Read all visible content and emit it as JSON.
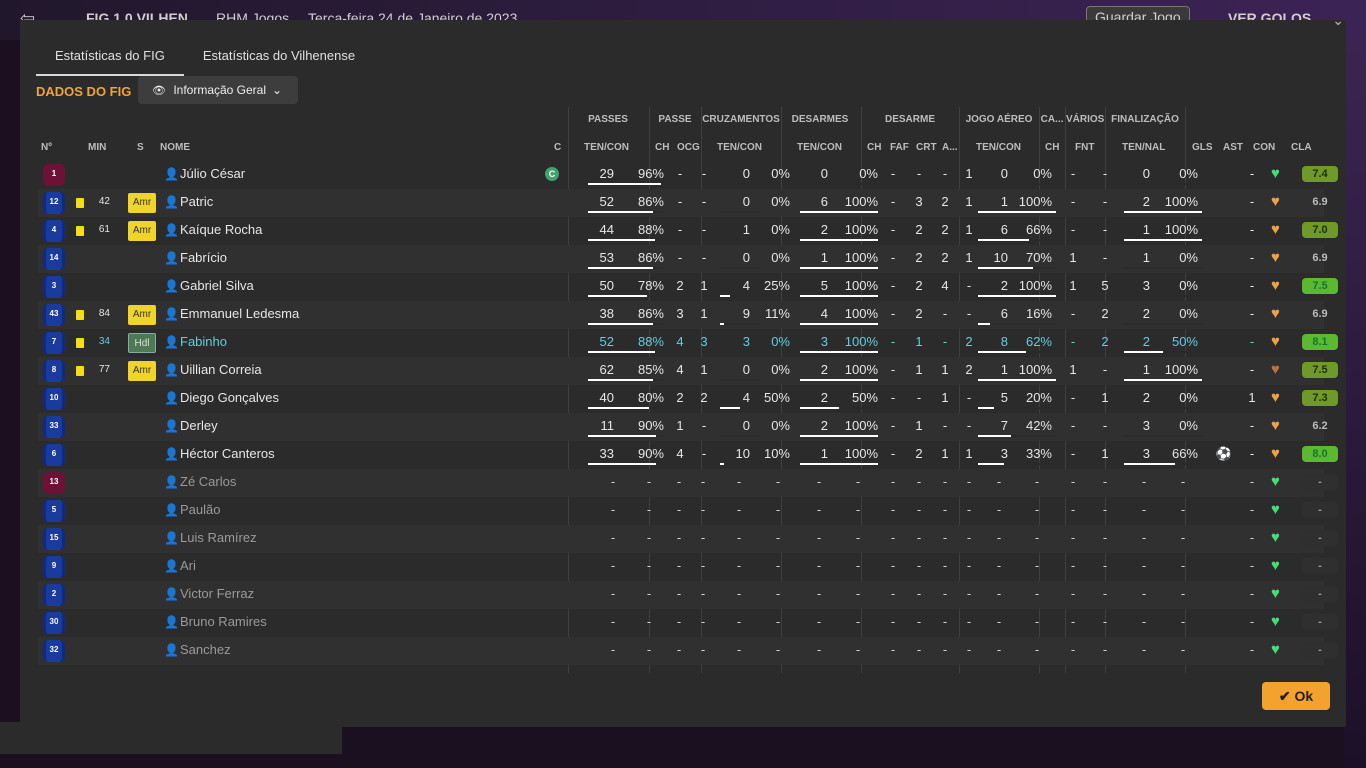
{
  "background": {
    "back_glyph": "⇦",
    "score": "FIG 1 0 VILHEN",
    "event": "RHM Jogos",
    "date": "Terça-feira 24 de Janeiro de 2023",
    "save_label": "Guardar Jogo",
    "goals_label": "VER GOLOS"
  },
  "tabs": [
    "Estatísticas do FIG",
    "Estatísticas do Vilhenense"
  ],
  "section_title": "DADOS DO FIG",
  "dropdown": {
    "label": "Informação Geral"
  },
  "group_headers": {
    "passes": "PASSES",
    "passe": "PASSE",
    "cruz": "CRUZAMENTOS",
    "desarmes": "DESARMES",
    "desarme": "DESARME",
    "aereo": "JOGO AÉREO",
    "ca": "CA...",
    "varios": "VÁRIOS",
    "final": "FINALIZAÇÃO"
  },
  "col_headers": {
    "no": "Nº",
    "min": "MIN",
    "s": "S",
    "nome": "NOME",
    "c": "C",
    "p_tc": "TEN/CON",
    "ps_ch": "CH",
    "ps_ocg": "OCG",
    "cr_tc": "TEN/CON",
    "ds_tc": "TEN/CON",
    "d_ch": "CH",
    "d_faf": "FAF",
    "d_crt": "CRT",
    "d_a": "A...",
    "ae_tc": "TEN/CON",
    "ca_ch": "CH",
    "v_fnt": "FNT",
    "f_tn": "TEN/NAL",
    "gls": "GLS",
    "ast": "AST",
    "con": "CON",
    "cla": "CLA"
  },
  "players": [
    {
      "no": "1",
      "gk": true,
      "min": "",
      "card": false,
      "pos": "",
      "name": "Júlio César",
      "captain": true,
      "p": [
        "29",
        "96%"
      ],
      "p_pct": 96,
      "ch": "-",
      "ocg": "-",
      "cr": [
        "0",
        "0%"
      ],
      "cr_pct": 0,
      "ds": [
        "0",
        "0%"
      ],
      "ds_pct": 0,
      "dch": "-",
      "faf": "-",
      "crt": "-",
      "da": "1",
      "ae": [
        "0",
        "0%"
      ],
      "ae_pct": 0,
      "cach": "-",
      "fnt": "-",
      "fi": [
        "0",
        "0%"
      ],
      "fi_pct": 0,
      "gls": "",
      "ast": "-",
      "con": "green",
      "cla": "7.4",
      "cla_lvl": "md"
    },
    {
      "no": "12",
      "gk": false,
      "min": "42",
      "card": true,
      "pos": "Amr",
      "name": "Patric",
      "captain": false,
      "p": [
        "52",
        "86%"
      ],
      "p_pct": 86,
      "ch": "-",
      "ocg": "-",
      "cr": [
        "0",
        "0%"
      ],
      "cr_pct": 0,
      "ds": [
        "6",
        "100%"
      ],
      "ds_pct": 100,
      "dch": "-",
      "faf": "3",
      "crt": "2",
      "da": "1",
      "ae": [
        "1",
        "100%"
      ],
      "ae_pct": 100,
      "cach": "-",
      "fnt": "-",
      "fi": [
        "2",
        "100%"
      ],
      "fi_pct": 100,
      "gls": "",
      "ast": "-",
      "con": "orange",
      "cla": "6.9",
      "cla_lvl": "lo"
    },
    {
      "no": "4",
      "gk": false,
      "min": "61",
      "card": true,
      "pos": "Amr",
      "name": "Kaíque Rocha",
      "captain": false,
      "p": [
        "44",
        "88%"
      ],
      "p_pct": 88,
      "ch": "-",
      "ocg": "-",
      "cr": [
        "1",
        "0%"
      ],
      "cr_pct": 0,
      "ds": [
        "2",
        "100%"
      ],
      "ds_pct": 100,
      "dch": "-",
      "faf": "2",
      "crt": "2",
      "da": "1",
      "ae": [
        "6",
        "66%"
      ],
      "ae_pct": 66,
      "cach": "-",
      "fnt": "-",
      "fi": [
        "1",
        "100%"
      ],
      "fi_pct": 100,
      "gls": "",
      "ast": "-",
      "con": "orange",
      "cla": "7.0",
      "cla_lvl": "md"
    },
    {
      "no": "14",
      "gk": false,
      "min": "",
      "card": false,
      "pos": "",
      "name": "Fabrício",
      "captain": false,
      "p": [
        "53",
        "86%"
      ],
      "p_pct": 86,
      "ch": "-",
      "ocg": "-",
      "cr": [
        "0",
        "0%"
      ],
      "cr_pct": 0,
      "ds": [
        "1",
        "100%"
      ],
      "ds_pct": 100,
      "dch": "-",
      "faf": "2",
      "crt": "2",
      "da": "1",
      "ae": [
        "10",
        "70%"
      ],
      "ae_pct": 70,
      "cach": "1",
      "fnt": "-",
      "fi": [
        "1",
        "0%"
      ],
      "fi_pct": 0,
      "gls": "",
      "ast": "-",
      "con": "orange",
      "cla": "6.9",
      "cla_lvl": "lo"
    },
    {
      "no": "3",
      "gk": false,
      "min": "",
      "card": false,
      "pos": "",
      "name": "Gabriel Silva",
      "captain": false,
      "p": [
        "50",
        "78%"
      ],
      "p_pct": 78,
      "ch": "2",
      "ocg": "1",
      "cr": [
        "4",
        "25%"
      ],
      "cr_pct": 25,
      "ds": [
        "5",
        "100%"
      ],
      "ds_pct": 100,
      "dch": "-",
      "faf": "2",
      "crt": "4",
      "da": "-",
      "ae": [
        "2",
        "100%"
      ],
      "ae_pct": 100,
      "cach": "1",
      "fnt": "5",
      "fi": [
        "3",
        "0%"
      ],
      "fi_pct": 0,
      "gls": "",
      "ast": "-",
      "con": "orange",
      "cla": "7.5",
      "cla_lvl": "hi"
    },
    {
      "no": "43",
      "gk": false,
      "min": "84",
      "card": true,
      "pos": "Amr",
      "name": "Emmanuel Ledesma",
      "captain": false,
      "p": [
        "38",
        "86%"
      ],
      "p_pct": 86,
      "ch": "3",
      "ocg": "1",
      "cr": [
        "9",
        "11%"
      ],
      "cr_pct": 11,
      "ds": [
        "4",
        "100%"
      ],
      "ds_pct": 100,
      "dch": "-",
      "faf": "2",
      "crt": "-",
      "da": "-",
      "ae": [
        "6",
        "16%"
      ],
      "ae_pct": 16,
      "cach": "-",
      "fnt": "2",
      "fi": [
        "2",
        "0%"
      ],
      "fi_pct": 0,
      "gls": "",
      "ast": "-",
      "con": "orange",
      "cla": "6.9",
      "cla_lvl": "lo"
    },
    {
      "no": "7",
      "gk": false,
      "min": "34",
      "card": true,
      "pos": "Hdl",
      "name": "Fabinho",
      "captain": false,
      "highlight": true,
      "p": [
        "52",
        "88%"
      ],
      "p_pct": 88,
      "ch": "4",
      "ocg": "3",
      "cr": [
        "3",
        "0%"
      ],
      "cr_pct": 0,
      "ds": [
        "3",
        "100%"
      ],
      "ds_pct": 100,
      "dch": "-",
      "faf": "1",
      "crt": "-",
      "da": "2",
      "ae": [
        "8",
        "62%"
      ],
      "ae_pct": 62,
      "cach": "-",
      "fnt": "2",
      "fi": [
        "2",
        "50%"
      ],
      "fi_pct": 50,
      "gls": "",
      "ast": "-",
      "con": "orange",
      "cla": "8.1",
      "cla_lvl": "hi"
    },
    {
      "no": "8",
      "gk": false,
      "min": "77",
      "card": true,
      "pos": "Amr",
      "name": "Uillian Correia",
      "captain": false,
      "p": [
        "62",
        "85%"
      ],
      "p_pct": 85,
      "ch": "4",
      "ocg": "1",
      "cr": [
        "0",
        "0%"
      ],
      "cr_pct": 0,
      "ds": [
        "2",
        "100%"
      ],
      "ds_pct": 100,
      "dch": "-",
      "faf": "1",
      "crt": "1",
      "da": "2",
      "ae": [
        "1",
        "100%"
      ],
      "ae_pct": 100,
      "cach": "1",
      "fnt": "-",
      "fi": [
        "1",
        "100%"
      ],
      "fi_pct": 100,
      "gls": "",
      "ast": "-",
      "con": "brown",
      "cla": "7.5",
      "cla_lvl": "md"
    },
    {
      "no": "10",
      "gk": false,
      "min": "",
      "card": false,
      "pos": "",
      "name": "Diego Gonçalves",
      "captain": false,
      "p": [
        "40",
        "80%"
      ],
      "p_pct": 80,
      "ch": "2",
      "ocg": "2",
      "cr": [
        "4",
        "50%"
      ],
      "cr_pct": 50,
      "ds": [
        "2",
        "50%"
      ],
      "ds_pct": 50,
      "dch": "-",
      "faf": "-",
      "crt": "1",
      "da": "-",
      "ae": [
        "5",
        "20%"
      ],
      "ae_pct": 20,
      "cach": "-",
      "fnt": "1",
      "fi": [
        "2",
        "0%"
      ],
      "fi_pct": 0,
      "gls": "",
      "ast": "1",
      "con": "orange",
      "cla": "7.3",
      "cla_lvl": "md"
    },
    {
      "no": "33",
      "gk": false,
      "min": "",
      "card": false,
      "pos": "",
      "name": "Derley",
      "captain": false,
      "p": [
        "11",
        "90%"
      ],
      "p_pct": 90,
      "ch": "1",
      "ocg": "-",
      "cr": [
        "0",
        "0%"
      ],
      "cr_pct": 0,
      "ds": [
        "2",
        "100%"
      ],
      "ds_pct": 100,
      "dch": "-",
      "faf": "1",
      "crt": "-",
      "da": "-",
      "ae": [
        "7",
        "42%"
      ],
      "ae_pct": 42,
      "cach": "-",
      "fnt": "-",
      "fi": [
        "3",
        "0%"
      ],
      "fi_pct": 0,
      "gls": "",
      "ast": "-",
      "con": "orange",
      "cla": "6.2",
      "cla_lvl": "lo"
    },
    {
      "no": "6",
      "gk": false,
      "min": "",
      "card": false,
      "pos": "",
      "name": "Héctor Canteros",
      "captain": false,
      "p": [
        "33",
        "90%"
      ],
      "p_pct": 90,
      "ch": "4",
      "ocg": "-",
      "cr": [
        "10",
        "10%"
      ],
      "cr_pct": 10,
      "ds": [
        "1",
        "100%"
      ],
      "ds_pct": 100,
      "dch": "-",
      "faf": "2",
      "crt": "1",
      "da": "1",
      "ae": [
        "3",
        "33%"
      ],
      "ae_pct": 33,
      "cach": "-",
      "fnt": "1",
      "fi": [
        "3",
        "66%"
      ],
      "fi_pct": 66,
      "gls": "⚽",
      "ast": "-",
      "con": "orange",
      "cla": "8.0",
      "cla_lvl": "hi"
    },
    {
      "no": "13",
      "gk": true,
      "sub": true,
      "name": "Zé Carlos",
      "con": "green",
      "cla": "-"
    },
    {
      "no": "5",
      "gk": false,
      "sub": true,
      "name": "Paulão",
      "con": "green",
      "cla": "-"
    },
    {
      "no": "15",
      "gk": false,
      "sub": true,
      "name": "Luis Ramírez",
      "con": "green",
      "cla": "-"
    },
    {
      "no": "9",
      "gk": false,
      "sub": true,
      "name": "Ari",
      "con": "green",
      "cla": "-"
    },
    {
      "no": "2",
      "gk": false,
      "sub": true,
      "name": "Victor Ferraz",
      "con": "green",
      "cla": "-"
    },
    {
      "no": "30",
      "gk": false,
      "sub": true,
      "name": "Bruno Ramires",
      "con": "green",
      "cla": "-"
    },
    {
      "no": "32",
      "gk": false,
      "sub": true,
      "name": "Sanchez",
      "con": "green",
      "cla": "-"
    }
  ],
  "ok_label": "Ok",
  "icons": {
    "person": "person-icon",
    "captain": "captain-badge",
    "eye": "eye-icon",
    "chevron": "chevron-down-icon",
    "heart": "heart-icon",
    "ok": "check-icon"
  }
}
